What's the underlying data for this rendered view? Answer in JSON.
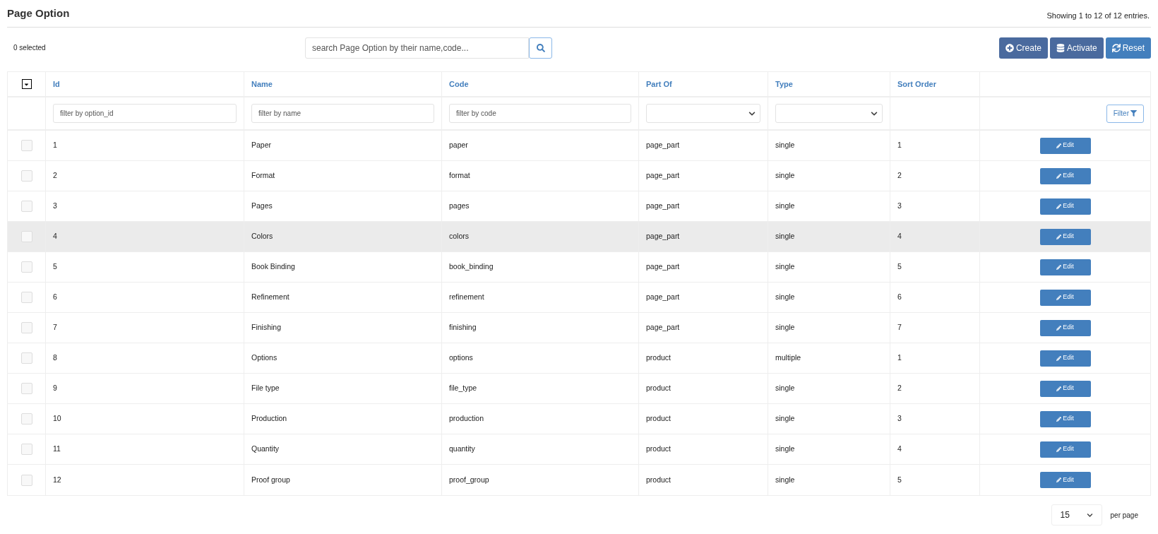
{
  "title": "Page Option",
  "summary": "Showing 1 to 12 of 12 entries.",
  "selected_count": "0 selected",
  "search": {
    "placeholder": "search Page Option by their name,code..."
  },
  "actions": [
    {
      "label": "Create",
      "kind": "create"
    },
    {
      "label": "Activate",
      "kind": "activate"
    },
    {
      "label": "Reset",
      "kind": "reset"
    }
  ],
  "table": {
    "columns": [
      "Id",
      "Name",
      "Code",
      "Part Of",
      "Type",
      "Sort Order"
    ],
    "filters": [
      {
        "kind": "text",
        "placeholder": "filter by option_id"
      },
      {
        "kind": "text",
        "placeholder": "filter by name"
      },
      {
        "kind": "text",
        "placeholder": "filter by code"
      },
      {
        "kind": "select"
      },
      {
        "kind": "select"
      },
      {
        "kind": "none"
      }
    ],
    "filter_button": "Filter",
    "rows": [
      {
        "id": "1",
        "name": "Paper",
        "code": "paper",
        "part_of": "page_part",
        "type": "single",
        "sort_order": "1",
        "checked": false,
        "highlighted": false,
        "action": "Edit"
      },
      {
        "id": "2",
        "name": "Format",
        "code": "format",
        "part_of": "page_part",
        "type": "single",
        "sort_order": "2",
        "checked": false,
        "highlighted": false,
        "action": "Edit"
      },
      {
        "id": "3",
        "name": "Pages",
        "code": "pages",
        "part_of": "page_part",
        "type": "single",
        "sort_order": "3",
        "checked": false,
        "highlighted": false,
        "action": "Edit"
      },
      {
        "id": "4",
        "name": "Colors",
        "code": "colors",
        "part_of": "page_part",
        "type": "single",
        "sort_order": "4",
        "checked": false,
        "highlighted": true,
        "action": "Edit"
      },
      {
        "id": "5",
        "name": "Book Binding",
        "code": "book_binding",
        "part_of": "page_part",
        "type": "single",
        "sort_order": "5",
        "checked": false,
        "highlighted": false,
        "action": "Edit"
      },
      {
        "id": "6",
        "name": "Refinement",
        "code": "refinement",
        "part_of": "page_part",
        "type": "single",
        "sort_order": "6",
        "checked": false,
        "highlighted": false,
        "action": "Edit"
      },
      {
        "id": "7",
        "name": "Finishing",
        "code": "finishing",
        "part_of": "page_part",
        "type": "single",
        "sort_order": "7",
        "checked": false,
        "highlighted": false,
        "action": "Edit"
      },
      {
        "id": "8",
        "name": "Options",
        "code": "options",
        "part_of": "product",
        "type": "multiple",
        "sort_order": "1",
        "checked": false,
        "highlighted": false,
        "action": "Edit"
      },
      {
        "id": "9",
        "name": "File type",
        "code": "file_type",
        "part_of": "product",
        "type": "single",
        "sort_order": "2",
        "checked": false,
        "highlighted": false,
        "action": "Edit"
      },
      {
        "id": "10",
        "name": "Production",
        "code": "production",
        "part_of": "product",
        "type": "single",
        "sort_order": "3",
        "checked": false,
        "highlighted": false,
        "action": "Edit"
      },
      {
        "id": "11",
        "name": "Quantity",
        "code": "quantity",
        "part_of": "product",
        "type": "single",
        "sort_order": "4",
        "checked": false,
        "highlighted": false,
        "action": "Edit"
      },
      {
        "id": "12",
        "name": "Proof group",
        "code": "proof_group",
        "part_of": "product",
        "type": "single",
        "sort_order": "5",
        "checked": false,
        "highlighted": false,
        "action": "Edit"
      }
    ]
  },
  "pagination": {
    "page_size": "15",
    "label": "per page"
  }
}
